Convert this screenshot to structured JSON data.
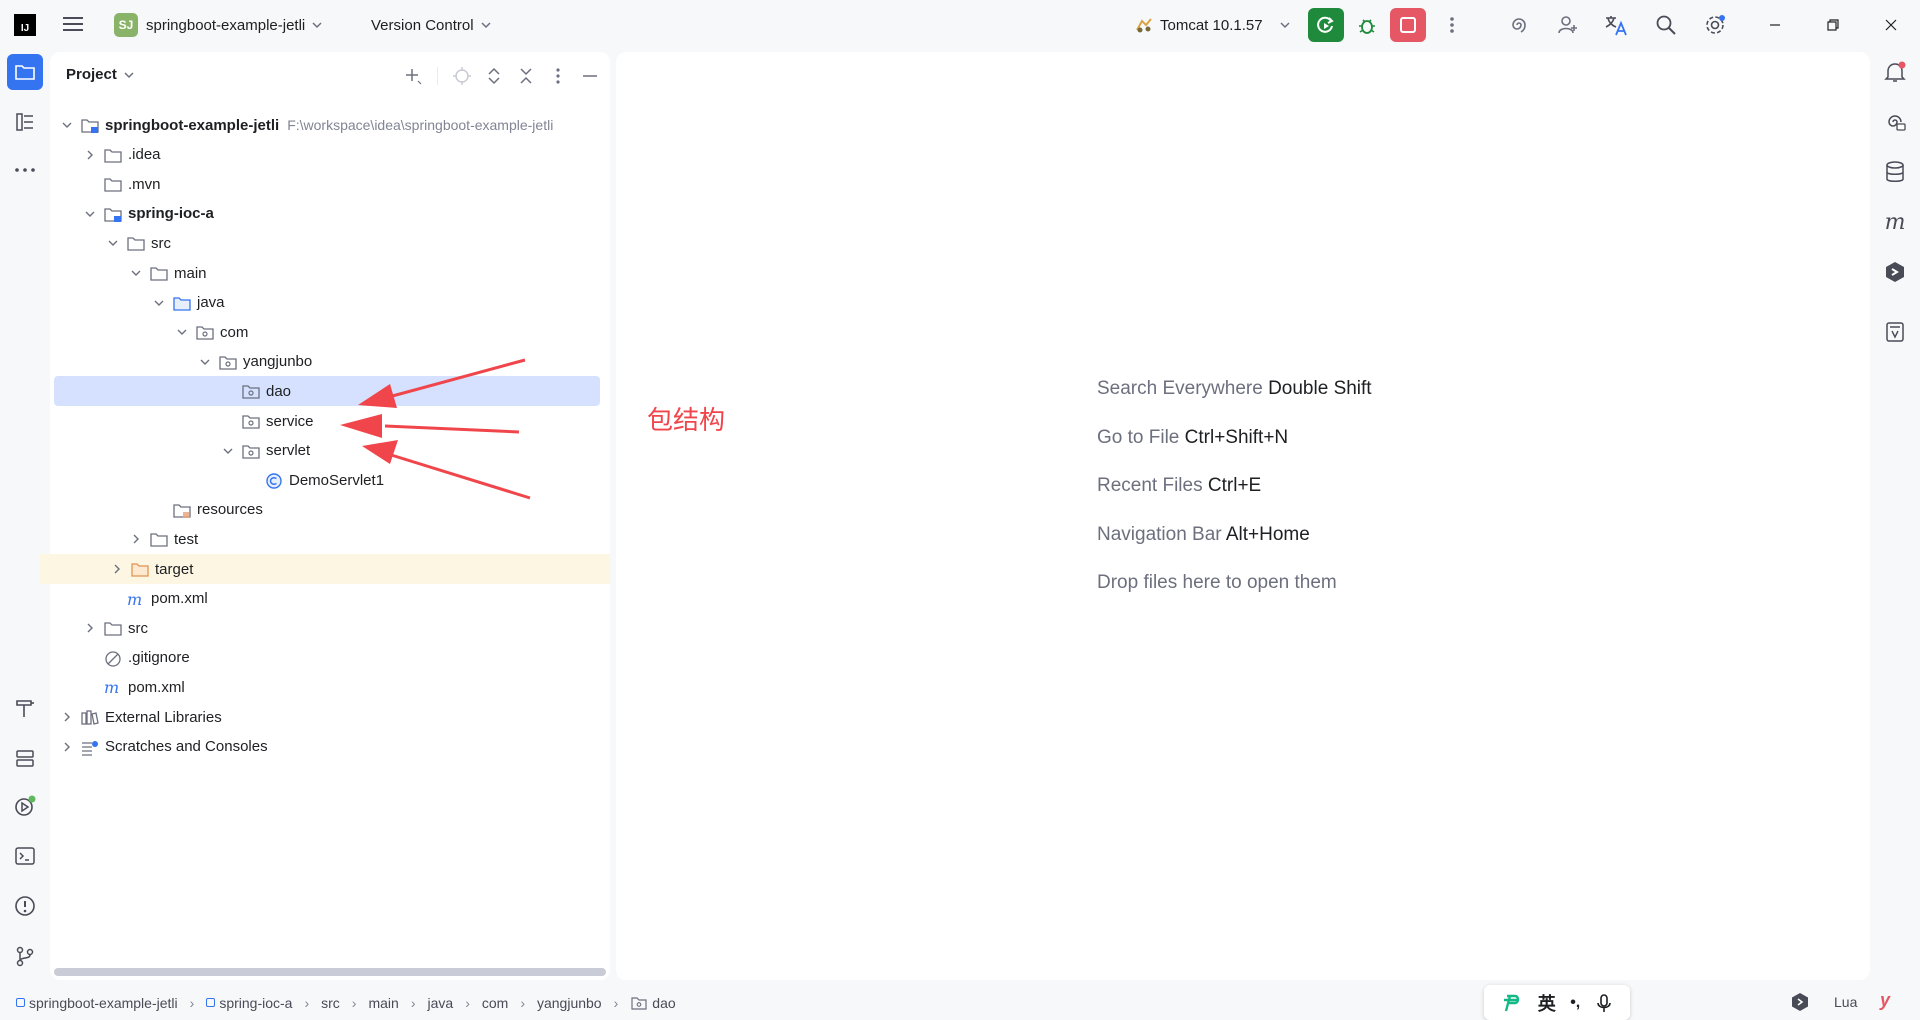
{
  "titlebar": {
    "logo_text": "IJ",
    "project_badge": "SJ",
    "project_name": "springboot-example-jetli",
    "vcs_label": "Version Control",
    "run_config": "Tomcat 10.1.57"
  },
  "panel": {
    "title": "Project"
  },
  "tree": [
    {
      "label": "springboot-example-jetli",
      "path": "F:\\workspace\\idea\\springboot-example-jetli",
      "level": 0,
      "chev": "down",
      "icon": "module-folder",
      "bold": true
    },
    {
      "label": ".idea",
      "level": 1,
      "chev": "right",
      "icon": "folder"
    },
    {
      "label": ".mvn",
      "level": 1,
      "chev": "none",
      "icon": "folder"
    },
    {
      "label": "spring-ioc-a",
      "level": 1,
      "chev": "down",
      "icon": "module-folder",
      "bold": true
    },
    {
      "label": "src",
      "level": 2,
      "chev": "down",
      "icon": "folder"
    },
    {
      "label": "main",
      "level": 3,
      "chev": "down",
      "icon": "folder"
    },
    {
      "label": "java",
      "level": 4,
      "chev": "down",
      "icon": "source-folder"
    },
    {
      "label": "com",
      "level": 5,
      "chev": "down",
      "icon": "package"
    },
    {
      "label": "yangjunbo",
      "level": 6,
      "chev": "down",
      "icon": "package"
    },
    {
      "label": "dao",
      "level": 7,
      "chev": "none",
      "icon": "package",
      "selected": true
    },
    {
      "label": "service",
      "level": 7,
      "chev": "none",
      "icon": "package"
    },
    {
      "label": "servlet",
      "level": 7,
      "chev": "down",
      "icon": "package"
    },
    {
      "label": "DemoServlet1",
      "level": 8,
      "chev": "none",
      "icon": "class"
    },
    {
      "label": "resources",
      "level": 4,
      "chev": "none",
      "icon": "resources-folder"
    },
    {
      "label": "test",
      "level": 3,
      "chev": "right",
      "icon": "folder"
    },
    {
      "label": "target",
      "level": 2,
      "chev": "right",
      "icon": "excluded-folder",
      "highlight": true
    },
    {
      "label": "pom.xml",
      "level": 2,
      "chev": "none",
      "icon": "maven"
    },
    {
      "label": "src",
      "level": 1,
      "chev": "right",
      "icon": "folder"
    },
    {
      "label": ".gitignore",
      "level": 1,
      "chev": "none",
      "icon": "ignore"
    },
    {
      "label": "pom.xml",
      "level": 1,
      "chev": "none",
      "icon": "maven"
    },
    {
      "label": "External Libraries",
      "level": 0,
      "chev": "right",
      "icon": "library"
    },
    {
      "label": "Scratches and Consoles",
      "level": 0,
      "chev": "right",
      "icon": "scratch"
    }
  ],
  "annotation": {
    "text": "包结构",
    "color": "#f0464b"
  },
  "hints": [
    {
      "label": "Search Everywhere",
      "shortcut": "Double Shift"
    },
    {
      "label": "Go to File",
      "shortcut": "Ctrl+Shift+N"
    },
    {
      "label": "Recent Files",
      "shortcut": "Ctrl+E"
    },
    {
      "label": "Navigation Bar",
      "shortcut": "Alt+Home"
    },
    {
      "label": "Drop files here to open them",
      "shortcut": ""
    }
  ],
  "breadcrumbs": [
    "springboot-example-jetli",
    "spring-ioc-a",
    "src",
    "main",
    "java",
    "com",
    "yangjunbo",
    "dao"
  ],
  "ime": {
    "lang": "英",
    "punct": "•,"
  },
  "status_right": {
    "language": "Lua"
  },
  "colors": {
    "accent": "#3574f0",
    "run_green": "#208a3c",
    "stop_red": "#e55765",
    "selection": "#d5e1ff",
    "highlight": "#fdf6e3"
  }
}
